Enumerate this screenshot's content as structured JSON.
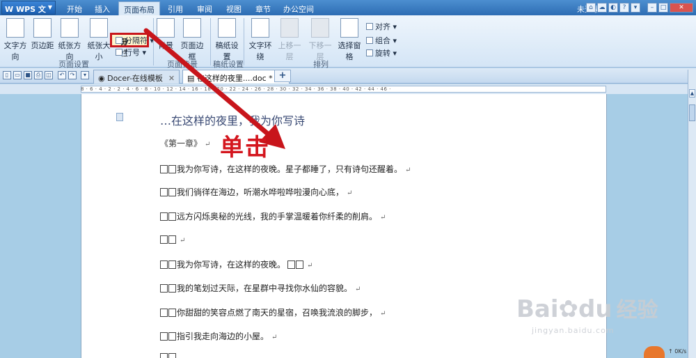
{
  "app": {
    "name": "WPS 文字",
    "login_status": "未登录"
  },
  "menu": [
    {
      "label": "开始"
    },
    {
      "label": "插入"
    },
    {
      "label": "页面布局"
    },
    {
      "label": "引用"
    },
    {
      "label": "审阅"
    },
    {
      "label": "视图"
    },
    {
      "label": "章节"
    },
    {
      "label": "办公空间"
    }
  ],
  "ribbon": {
    "text_direction": "文字方向",
    "margins": "页边距",
    "orientation": "纸张方向",
    "paper_size": "纸张大小",
    "columns": "分栏",
    "breaks": "分隔符",
    "line_numbers": "行号",
    "background": "背景",
    "page_border": "页面边框",
    "manuscript": "稿纸设置",
    "text_wrap": "文字环绕",
    "bring_forward": "上移一层",
    "send_backward": "下移一层",
    "selection_pane": "选择窗格",
    "align": "对齐",
    "group": "组合",
    "rotate": "旋转",
    "group_page_setup": "页面设置",
    "group_page_bg": "页面背景",
    "group_manuscript": "稿纸设置",
    "group_arrange": "排列"
  },
  "tabs": [
    {
      "label": "Docer-在线模板"
    },
    {
      "label": "在这样的夜里....doc *"
    }
  ],
  "ruler": {
    "ticks": "8 · 6 · 4 · 2 · 2 · 4 · 6 · 8 · 10 · 12 · 14 · 16 · 18 · 20 · 22 · 24 · 26 · 28 · 30 · 32 · 34 · 36 · 38 · 40 · 42 · 44 · 46 ·"
  },
  "document": {
    "title": "…在这样的夜里，我为你写诗",
    "chapter": "《第一章》",
    "lines": [
      "我为你写诗，在这样的夜晚。星子都睡了，只有诗句还醒着。",
      "我们徜徉在海边，听潮水哗啦哗啦漫向心底，",
      "远方闪烁奥秘的光线，我的手掌温暖着你纤柔的削肩。",
      "",
      "我为你写诗，在这样的夜晚。",
      "我的笔划过天际，在星群中寻找你水仙的容貌。",
      "你甜甜的笑容点燃了南天的星宿，召唤我流浪的脚步，",
      "指引我走向海边的小屋。"
    ]
  },
  "annotation": {
    "text": "单击",
    "color": "#d4161e"
  },
  "watermark": {
    "brand": "Bai",
    "brand2": "du",
    "cn": "经验",
    "url": "jingyan.baidu.com"
  },
  "speed": {
    "value": "0K/s",
    "badge": "↑"
  }
}
